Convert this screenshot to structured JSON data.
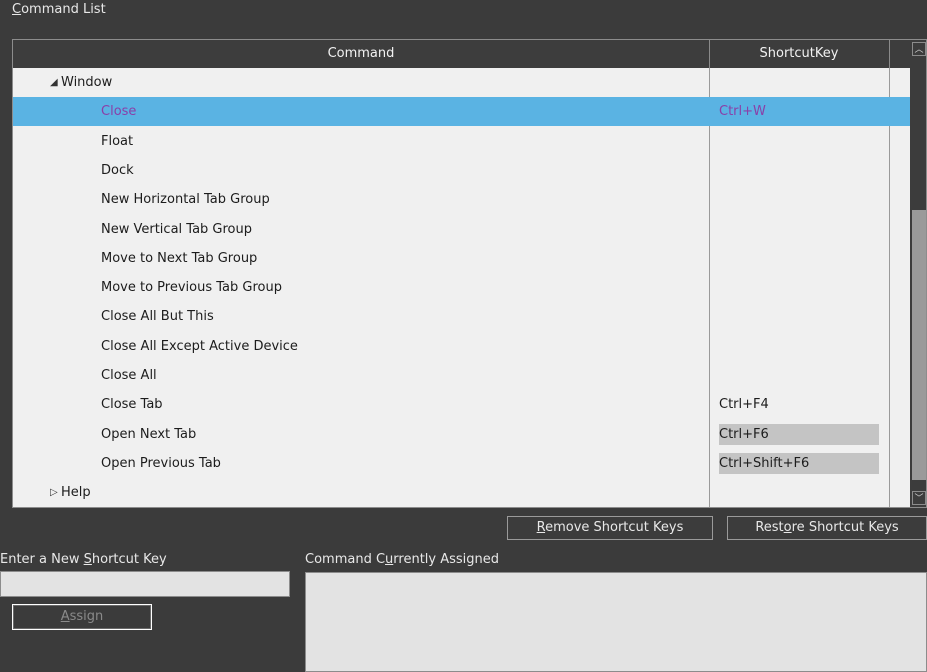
{
  "title": {
    "prefix": "",
    "accel": "C",
    "rest": "ommand List"
  },
  "grid": {
    "columns": {
      "command": "Command",
      "shortcut": "ShortcutKey"
    },
    "rows": [
      {
        "label": "Window",
        "key": "",
        "type": "group-expanded",
        "arrow": "◢"
      },
      {
        "label": "Close",
        "key": "Ctrl+W",
        "type": "item",
        "selected": true
      },
      {
        "label": "Float",
        "key": "",
        "type": "item"
      },
      {
        "label": "Dock",
        "key": "",
        "type": "item"
      },
      {
        "label": "New Horizontal Tab Group",
        "key": "",
        "type": "item"
      },
      {
        "label": "New Vertical Tab Group",
        "key": "",
        "type": "item"
      },
      {
        "label": "Move to Next Tab Group",
        "key": "",
        "type": "item"
      },
      {
        "label": "Move to Previous Tab Group",
        "key": "",
        "type": "item"
      },
      {
        "label": "Close All But This",
        "key": "",
        "type": "item"
      },
      {
        "label": "Close All Except Active Device",
        "key": "",
        "type": "item"
      },
      {
        "label": "Close All",
        "key": "",
        "type": "item"
      },
      {
        "label": "Close Tab",
        "key": "Ctrl+F4",
        "type": "item"
      },
      {
        "label": "Open Next Tab",
        "key": "Ctrl+F6",
        "type": "item",
        "shaded": true
      },
      {
        "label": "Open Previous Tab",
        "key": "Ctrl+Shift+F6",
        "type": "item",
        "shaded": true
      },
      {
        "label": "Help",
        "key": "",
        "type": "group-collapsed",
        "arrow": "▷"
      }
    ]
  },
  "buttons": {
    "remove": {
      "accel": "R",
      "rest": "emove Shortcut Keys"
    },
    "restore": {
      "pre": "Rest",
      "accel": "o",
      "rest": "re Shortcut Keys"
    },
    "assign": {
      "accel": "A",
      "rest": "ssign"
    }
  },
  "labels": {
    "new_key": {
      "pre": "Enter a New ",
      "accel": "S",
      "rest": "hortcut Key"
    },
    "assigned": {
      "pre": "Command C",
      "accel": "u",
      "rest": "rrently Assigned"
    }
  },
  "colors": {
    "selection": "#5ab3e3",
    "selected_text": "#8a3fa8"
  },
  "icons": {
    "scroll_up": "chevron-up-icon",
    "scroll_down": "chevron-down-icon",
    "expanded": "triangle-expanded-icon",
    "collapsed": "triangle-collapsed-icon"
  }
}
